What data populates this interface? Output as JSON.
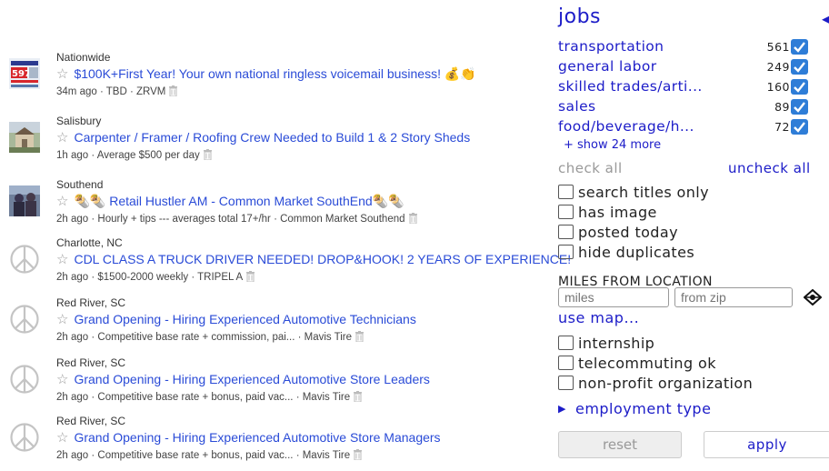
{
  "listings": [
    {
      "location": "Nationwide",
      "title": "$100K+First Year! Your own national ringless voicemail business! 💰👏",
      "meta": "34m ago · TBD · ZRVM",
      "thumb": "photo"
    },
    {
      "location": "Salisbury",
      "title": "Carpenter / Framer / Roofing Crew Needed to Build 1 & 2 Story Sheds",
      "meta": "1h ago · Average $500 per day",
      "thumb": "photo"
    },
    {
      "location": "Southend",
      "title": "🌯🌯 Retail Hustler AM - Common Market SouthEnd🌯🌯",
      "meta": "2h ago · Hourly + tips --- averages total 17+/hr · Common Market Southend",
      "thumb": "photo"
    },
    {
      "location": "Charlotte, NC",
      "title": "CDL CLASS A TRUCK DRIVER NEEDED! DROP&HOOK! 2 YEARS OF EXPERIENCE!",
      "meta": "2h ago · $1500-2000 weekly · TRIPEL A",
      "thumb": "peace"
    },
    {
      "location": "Red River, SC",
      "title": "Grand Opening - Hiring Experienced Automotive Technicians",
      "meta": "2h ago · Competitive base rate + commission, pai... · Mavis Tire",
      "thumb": "peace"
    },
    {
      "location": "Red River, SC",
      "title": "Grand Opening - Hiring Experienced Automotive Store Leaders",
      "meta": "2h ago · Competitive base rate + bonus, paid vac... · Mavis Tire",
      "thumb": "peace"
    },
    {
      "location": "Red River, SC",
      "title": "Grand Opening - Hiring Experienced Automotive Store Managers",
      "meta": "2h ago · Competitive base rate + bonus, paid vac... · Mavis Tire",
      "thumb": "peace"
    }
  ],
  "icons": {
    "star": "star-outline-icon",
    "trash": "trash-icon",
    "peace": "peace-placeholder-icon"
  },
  "panel": {
    "heading": "jobs",
    "back_glyph": "◀",
    "categories": [
      {
        "name": "transportation",
        "count": "561",
        "checked": true
      },
      {
        "name": "general labor",
        "count": "249",
        "checked": true
      },
      {
        "name": "skilled trades/arti...",
        "count": "160",
        "checked": true
      },
      {
        "name": "sales",
        "count": "89",
        "checked": true
      },
      {
        "name": "food/beverage/h...",
        "count": "72",
        "checked": true
      }
    ],
    "show_more": "+ show 24 more",
    "check_all": "check all",
    "uncheck_all": "uncheck all",
    "options": [
      "search titles only",
      "has image",
      "posted today",
      "hide duplicates"
    ],
    "miles_label": "MILES FROM LOCATION",
    "miles_placeholder": "miles",
    "zip_placeholder": "from zip",
    "use_map": "use map...",
    "extra_options": [
      "internship",
      "telecommuting ok",
      "non-profit organization"
    ],
    "employment_type": "employment type",
    "reset": "reset",
    "apply": "apply"
  },
  "colors": {
    "link": "#2a4bd7",
    "panel_link": "#1c1cc8",
    "checkbox": "#2e7dd7"
  }
}
